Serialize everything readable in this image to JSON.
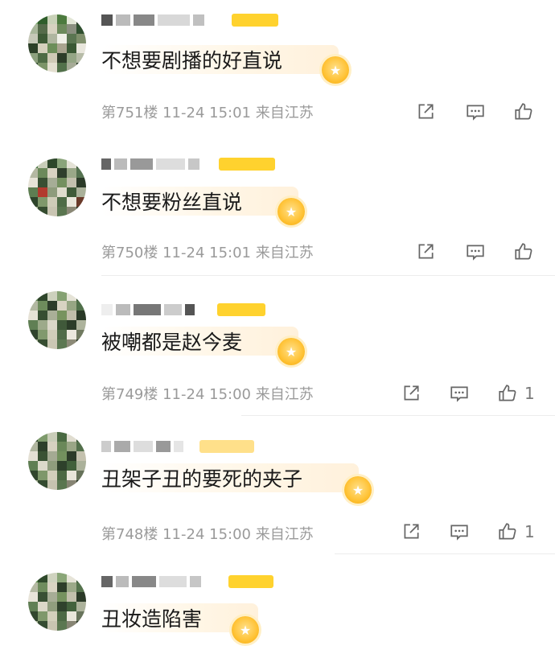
{
  "comments": [
    {
      "text": "不想要剧播的好直说",
      "floor": "第751楼",
      "time": "11-24 15:01",
      "location": "来自江苏",
      "likes": ""
    },
    {
      "text": "不想要粉丝直说",
      "floor": "第750楼",
      "time": "11-24 15:01",
      "location": "来自江苏",
      "likes": ""
    },
    {
      "text": "被嘲都是赵今麦",
      "floor": "第749楼",
      "time": "11-24 15:00",
      "location": "来自江苏",
      "likes": "1"
    },
    {
      "text": "丑架子丑的要死的夹子",
      "floor": "第748楼",
      "time": "11-24 15:00",
      "location": "来自江苏",
      "likes": "1"
    },
    {
      "text": "丑妆造陷害",
      "floor": "",
      "time": "",
      "location": "",
      "likes": ""
    }
  ],
  "icons": {
    "share": "share-icon",
    "reply": "comment-icon",
    "like": "thumbs-up-icon",
    "medal": "star-medal-icon"
  },
  "colors": {
    "meta_text": "#9a9a9a",
    "badge": "#ffd22e",
    "medal": "#ffc43a"
  }
}
